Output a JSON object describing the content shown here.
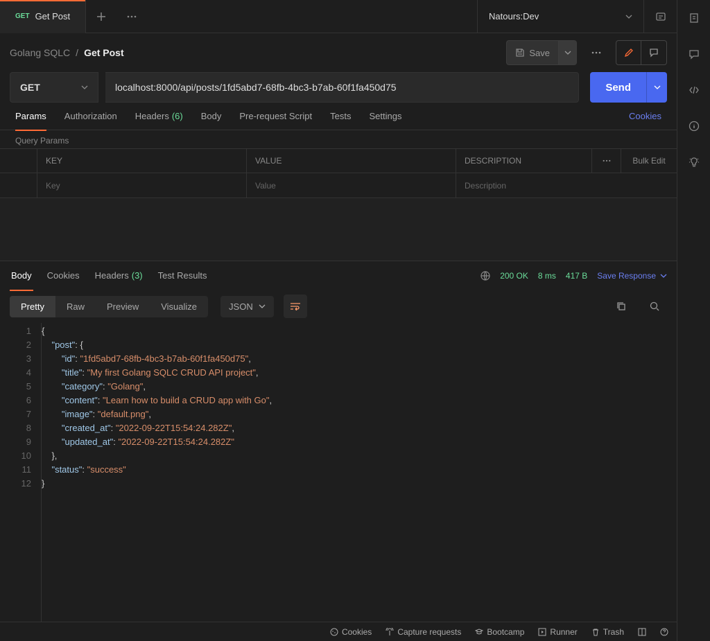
{
  "tab": {
    "method": "GET",
    "label": "Get Post"
  },
  "environment": "Natours:Dev",
  "breadcrumb": {
    "parent": "Golang SQLC",
    "sep": "/",
    "current": "Get Post"
  },
  "save_label": "Save",
  "request": {
    "method": "GET",
    "url": "localhost:8000/api/posts/1fd5abd7-68fb-4bc3-b7ab-60f1fa450d75",
    "send_label": "Send"
  },
  "req_tabs": {
    "params": "Params",
    "auth": "Authorization",
    "headers": "Headers",
    "headers_count": "(6)",
    "body": "Body",
    "prerequest": "Pre-request Script",
    "tests": "Tests",
    "settings": "Settings",
    "cookies": "Cookies"
  },
  "query_params_label": "Query Params",
  "table": {
    "key": "KEY",
    "value": "VALUE",
    "desc": "DESCRIPTION",
    "bulk": "Bulk Edit",
    "key_ph": "Key",
    "value_ph": "Value",
    "desc_ph": "Description"
  },
  "resp_tabs": {
    "body": "Body",
    "cookies": "Cookies",
    "headers": "Headers",
    "headers_count": "(3)",
    "test_results": "Test Results"
  },
  "resp_status": {
    "status": "200 OK",
    "time": "8 ms",
    "size": "417 B",
    "save": "Save Response"
  },
  "view_tabs": {
    "pretty": "Pretty",
    "raw": "Raw",
    "preview": "Preview",
    "visualize": "Visualize"
  },
  "format_label": "JSON",
  "response_body": {
    "post": {
      "id": "1fd5abd7-68fb-4bc3-b7ab-60f1fa450d75",
      "title": "My first Golang SQLC CRUD API project",
      "category": "Golang",
      "content": "Learn how to build a CRUD app with Go",
      "image": "default.png",
      "created_at": "2022-09-22T15:54:24.282Z",
      "updated_at": "2022-09-22T15:54:24.282Z"
    },
    "status": "success"
  },
  "footer": {
    "cookies": "Cookies",
    "capture": "Capture requests",
    "bootcamp": "Bootcamp",
    "runner": "Runner",
    "trash": "Trash"
  }
}
